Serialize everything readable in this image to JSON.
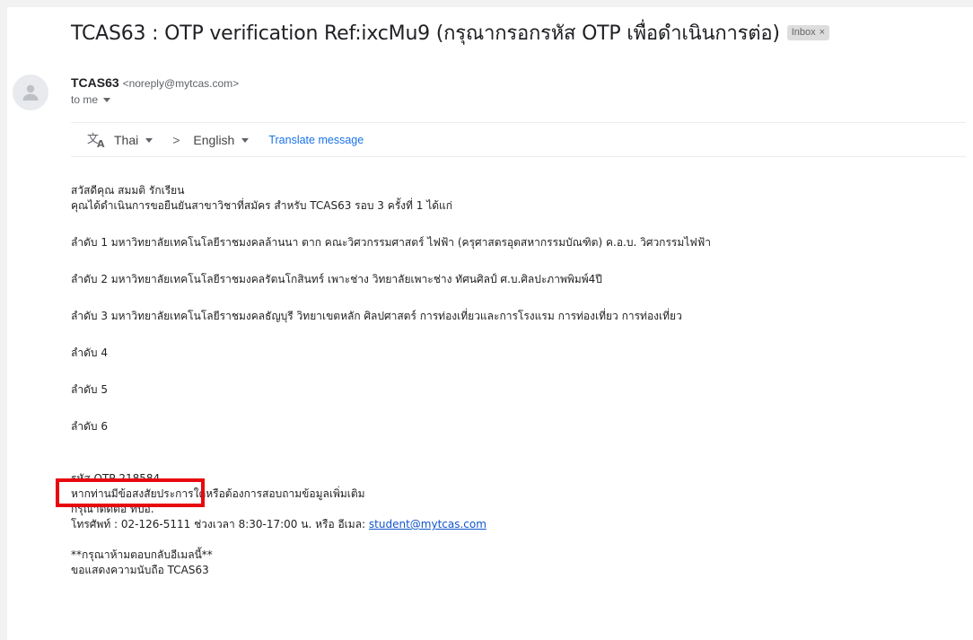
{
  "email": {
    "subject": "TCAS63 : OTP verification Ref:ixcMu9 (กรุณากรอกรหัส OTP เพื่อดำเนินการต่อ)",
    "label": "Inbox",
    "label_close": "×",
    "sender_name": "TCAS63",
    "sender_email": "<noreply@mytcas.com>",
    "to": "to me"
  },
  "translate": {
    "from_lang": "Thai",
    "arrow": ">",
    "to_lang": "English",
    "link": "Translate message"
  },
  "body": {
    "greeting": "สวัสดีคุณ สมมติ รักเรียน",
    "intro": "คุณได้ดำเนินการขอยืนยันสาขาวิชาที่สมัคร สำหรับ TCAS63 รอบ 3 ครั้งที่ 1 ได้แก่",
    "rank1": "ลำดับ 1 มหาวิทยาลัยเทคโนโลยีราชมงคลล้านนา ตาก คณะวิศวกรรมศาสตร์ ไฟฟ้า (ครุศาสตรอุตสหากรรมบัณฑิต) ค.อ.บ. วิศวกรรมไฟฟ้า",
    "rank2": "ลำดับ 2 มหาวิทยาลัยเทคโนโลยีราชมงคลรัตนโกสินทร์ เพาะช่าง วิทยาลัยเพาะช่าง ทัศนศิลป์ ศ.บ.ศิลปะภาพพิมพ์4ปี",
    "rank3": "ลำดับ 3 มหาวิทยาลัยเทคโนโลยีราชมงคลธัญบุรี วิทยาเขตหลัก ศิลปศาสตร์ การท่องเที่ยวและการโรงแรม การท่องเที่ยว การท่องเที่ยว",
    "rank4": "ลำดับ 4",
    "rank5": "ลำดับ 5",
    "rank6": "ลำดับ 6",
    "otp": "รหัส OTP 218584",
    "question": "หากท่านมีข้อสงสัยประการใดหรือต้องการสอบถามข้อมูลเพิ่มเติม",
    "contact": "กรุณาติดต่อ ทปอ.",
    "phone_prefix": "โทรศัพท์ : 02-126-5111 ช่วงเวลา 8:30-17:00 น. หรือ อีเมล: ",
    "email_link": "student@mytcas.com",
    "no_reply": "**กรุณาห้ามตอบกลับอีเมลนี้**",
    "thanks": "ขอแสดงความนับถือ TCAS63"
  },
  "colors": {
    "highlight": "#e8090f",
    "link": "#1155cc",
    "translate_link": "#1a73e8"
  }
}
